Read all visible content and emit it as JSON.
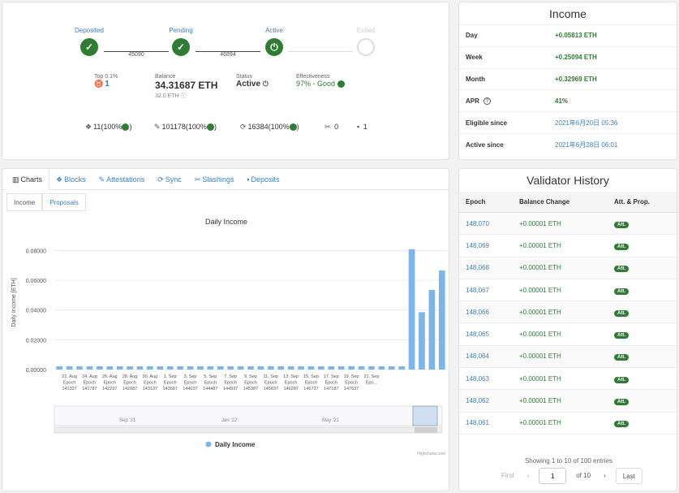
{
  "stepper": {
    "steps": [
      {
        "label": "Deposited",
        "state": "done"
      },
      {
        "label": "Pending",
        "state": "done"
      },
      {
        "label": "Active",
        "state": "current"
      },
      {
        "label": "Exited",
        "state": "future"
      }
    ],
    "links": [
      "45090",
      "46894"
    ]
  },
  "stats": {
    "rank_label": "Top 0.1%",
    "rank_value": "1",
    "balance_label": "Balance",
    "balance_value": "34.31687 ETH",
    "balance_sub": "32.0 ETH",
    "status_label": "Status",
    "status_value": "Active",
    "effectiveness_label": "Effectiveness",
    "effectiveness_value": "97% - Good"
  },
  "counts": {
    "proposals": "11(100%",
    "attestations": "101178(100%",
    "sync": "16384(100%",
    "slashings": "0",
    "deposits": "1"
  },
  "income": {
    "title": "Income",
    "rows": [
      {
        "label": "Day",
        "value": "+0.05813 ETH",
        "style": "green"
      },
      {
        "label": "Week",
        "value": "+0.25094 ETH",
        "style": "green"
      },
      {
        "label": "Month",
        "value": "+0.32969 ETH",
        "style": "green"
      },
      {
        "label": "APR",
        "value": "41%",
        "style": "green"
      },
      {
        "label": "Eligible since",
        "value": "2021年6月20日 05:36",
        "style": "plain"
      },
      {
        "label": "Active since",
        "value": "2021年6月28日 06:01",
        "style": "plain"
      }
    ]
  },
  "tabs": [
    "Charts",
    "Blocks",
    "Attestations",
    "Sync",
    "Slashings",
    "Deposits"
  ],
  "tab_icons": [
    "chart-icon",
    "cubes-icon",
    "attestation-icon",
    "sync-icon",
    "slashing-icon",
    "deposit-icon"
  ],
  "subtabs": [
    "Income",
    "Proposals"
  ],
  "chart_data": {
    "type": "bar",
    "title": "Daily Income",
    "ylabel": "Daily Income [ETH]",
    "xlabel": "",
    "ylim": [
      0,
      0.09
    ],
    "yticks": [
      "0.00000",
      "0.02000",
      "0.04000",
      "0.06000",
      "0.08000"
    ],
    "legend": "Daily Income",
    "credits": "Highcharts.com",
    "bar_color": "#7cb5ec",
    "values": [
      0.0005,
      0.0005,
      0.0005,
      0.0005,
      0.0005,
      0.0005,
      0.0005,
      0.0005,
      0.0005,
      0.0005,
      0.0005,
      0.0005,
      0.0005,
      0.0005,
      0.0005,
      0.0005,
      0.0005,
      0.0005,
      0.0005,
      0.0005,
      0.0005,
      0.0005,
      0.0005,
      0.0005,
      0.0005,
      0.0005,
      0.0005,
      0.0005,
      0.0005,
      0.0005,
      0.0005,
      0.0005,
      0.0005,
      0.0005,
      0.0005,
      0.0808,
      0.0385,
      0.0535,
      0.0665
    ],
    "tick_labels": [
      {
        "index": 1,
        "lines": [
          "22. Aug",
          "Epoch",
          "141337"
        ]
      },
      {
        "index": 3,
        "lines": [
          "24. Aug",
          "Epoch",
          "141787"
        ]
      },
      {
        "index": 5,
        "lines": [
          "26. Aug",
          "Epoch",
          "142237"
        ]
      },
      {
        "index": 7,
        "lines": [
          "28. Aug",
          "Epoch",
          "142687"
        ]
      },
      {
        "index": 9,
        "lines": [
          "30. Aug",
          "Epoch",
          "143137"
        ]
      },
      {
        "index": 11,
        "lines": [
          "1. Sep",
          "Epoch",
          "143587"
        ]
      },
      {
        "index": 13,
        "lines": [
          "3. Sep",
          "Epoch",
          "144037"
        ]
      },
      {
        "index": 15,
        "lines": [
          "5. Sep",
          "Epoch",
          "144487"
        ]
      },
      {
        "index": 17,
        "lines": [
          "7. Sep",
          "Epoch",
          "144937"
        ]
      },
      {
        "index": 19,
        "lines": [
          "9. Sep",
          "Epoch",
          "145387"
        ]
      },
      {
        "index": 21,
        "lines": [
          "11. Sep",
          "Epoch",
          "145837"
        ]
      },
      {
        "index": 23,
        "lines": [
          "13. Sep",
          "Epoch",
          "146287"
        ]
      },
      {
        "index": 25,
        "lines": [
          "15. Sep",
          "Epoch",
          "146737"
        ]
      },
      {
        "index": 27,
        "lines": [
          "17. Sep",
          "Epoch",
          "147187"
        ]
      },
      {
        "index": 29,
        "lines": [
          "19. Sep",
          "Epoch",
          "147637"
        ]
      },
      {
        "index": 31,
        "lines": [
          "21. Sep",
          "Epo..."
        ]
      }
    ],
    "navigator_labels": [
      "Sep '21",
      "Jan '22",
      "May '22"
    ]
  },
  "history": {
    "title": "Validator History",
    "columns": [
      "Epoch",
      "Balance Change",
      "Att. & Prop."
    ],
    "rows": [
      {
        "epoch": "148,070",
        "change": "+0.00001 ETH",
        "badge": "Att."
      },
      {
        "epoch": "148,069",
        "change": "+0.00001 ETH",
        "badge": "Att."
      },
      {
        "epoch": "148,068",
        "change": "+0.00001 ETH",
        "badge": "Att."
      },
      {
        "epoch": "148,067",
        "change": "+0.00001 ETH",
        "badge": "Att."
      },
      {
        "epoch": "148,066",
        "change": "+0.00001 ETH",
        "badge": "Att."
      },
      {
        "epoch": "148,065",
        "change": "+0.00001 ETH",
        "badge": "Att."
      },
      {
        "epoch": "148,064",
        "change": "+0.00001 ETH",
        "badge": "Att."
      },
      {
        "epoch": "148,063",
        "change": "+0.00001 ETH",
        "badge": "Att."
      },
      {
        "epoch": "148,062",
        "change": "+0.00001 ETH",
        "badge": "Att."
      },
      {
        "epoch": "148,061",
        "change": "+0.00001 ETH",
        "badge": "Att."
      }
    ],
    "entries_text": "Showing 1 to 10 of 100 entries",
    "pager": {
      "first": "First",
      "prev": "‹",
      "page": "1",
      "of": "of 10",
      "next": "›",
      "last": "Last"
    }
  },
  "colors": {
    "green": "#2e7d32",
    "link": "#3b7fc4",
    "bar": "#7cb5ec"
  }
}
